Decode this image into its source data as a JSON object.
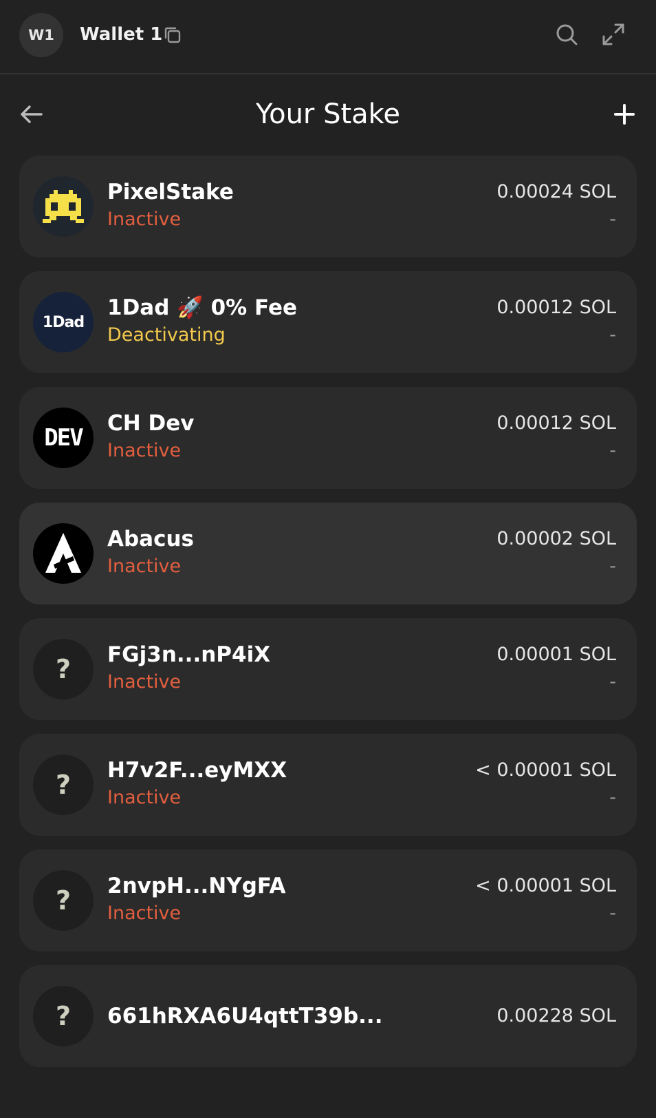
{
  "header": {
    "avatar_initials": "W1",
    "wallet_name": "Wallet 1",
    "icons": [
      "copy-icon",
      "search-icon",
      "expand-icon"
    ]
  },
  "page": {
    "title": "Your Stake",
    "back_icon": "arrow-left-icon",
    "add_icon": "plus-icon"
  },
  "colors": {
    "background": "#222222",
    "card": "#2b2b2b",
    "card_hover": "#333333",
    "inactive": "#e35f3f",
    "deactivating": "#f2c94c"
  },
  "stakes": [
    {
      "name": "PixelStake",
      "status": "Inactive",
      "status_color": "#e35f3f",
      "amount": "0.00024 SOL",
      "sub": "-",
      "logo": "pixel-invader-logo"
    },
    {
      "name": "1Dad 🚀 0% Fee",
      "status": "Deactivating",
      "status_color": "#f2c94c",
      "amount": "0.00012 SOL",
      "sub": "-",
      "logo": "1dad-logo",
      "logo_text": "1Dad"
    },
    {
      "name": "CH Dev",
      "status": "Inactive",
      "status_color": "#e35f3f",
      "amount": "0.00012 SOL",
      "sub": "-",
      "logo": "dev-logo",
      "logo_text": "DEV"
    },
    {
      "name": "Abacus",
      "status": "Inactive",
      "status_color": "#e35f3f",
      "amount": "0.00002 SOL",
      "sub": "-",
      "logo": "abacus-logo"
    },
    {
      "name": "FGj3n...nP4iX",
      "status": "Inactive",
      "status_color": "#e35f3f",
      "amount": "0.00001 SOL",
      "sub": "-",
      "logo": "unknown-validator-icon",
      "logo_text": "?"
    },
    {
      "name": "H7v2F...eyMXX",
      "status": "Inactive",
      "status_color": "#e35f3f",
      "amount": "< 0.00001 SOL",
      "sub": "-",
      "logo": "unknown-validator-icon",
      "logo_text": "?"
    },
    {
      "name": "2nvpH...NYgFA",
      "status": "Inactive",
      "status_color": "#e35f3f",
      "amount": "< 0.00001 SOL",
      "sub": "-",
      "logo": "unknown-validator-icon",
      "logo_text": "?"
    },
    {
      "name": "661hRXA6U4qttT39b...",
      "amount": "0.00228 SOL",
      "logo": "unknown-validator-icon",
      "logo_text": "?"
    }
  ]
}
